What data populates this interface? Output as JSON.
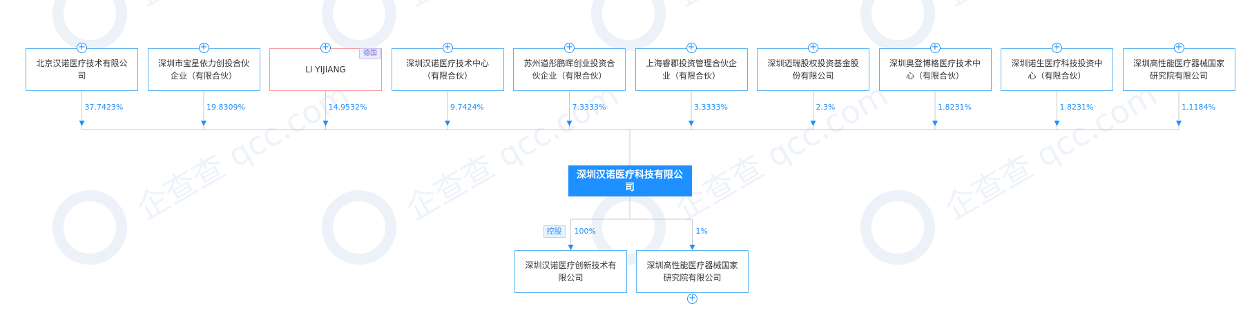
{
  "watermark": "企查查 qcc.com",
  "company": {
    "name": "深圳汉诺医疗科技有限公司"
  },
  "shareholders": [
    {
      "name": "北京汉诺医疗技术有限公司",
      "percent": "37.7423%"
    },
    {
      "name": "深圳市宝星依力创投合伙企业（有限合伙）",
      "percent": "19.8309%"
    },
    {
      "name": "LI YIJIANG",
      "percent": "14.9532%",
      "nationality": "德国",
      "is_person": true
    },
    {
      "name": "深圳汉诺医疗技术中心（有限合伙）",
      "percent": "9.7424%"
    },
    {
      "name": "苏州道彤鹏晖创业投资合伙企业（有限合伙）",
      "percent": "7.3333%"
    },
    {
      "name": "上海睿郡投资管理合伙企业（有限合伙）",
      "percent": "3.3333%"
    },
    {
      "name": "深圳迈瑞股权投资基金股份有限公司",
      "percent": "2.3%"
    },
    {
      "name": "深圳奥登博格医疗技术中心（有限合伙）",
      "percent": "1.8231%"
    },
    {
      "name": "深圳诺生医疗科技投资中心（有限合伙）",
      "percent": "1.8231%"
    },
    {
      "name": "深圳高性能医疗器械国家研究院有限公司",
      "percent": "1.1184%"
    }
  ],
  "subsidiaries": [
    {
      "name": "深圳汉诺医疗创新技术有限公司",
      "percent": "100%",
      "badge": "控股"
    },
    {
      "name": "深圳高性能医疗器械国家研究院有限公司",
      "percent": "1%"
    }
  ],
  "colors": {
    "accent": "#1e90ff",
    "border": "#5bb4f5",
    "person_border": "#f59a9f"
  }
}
